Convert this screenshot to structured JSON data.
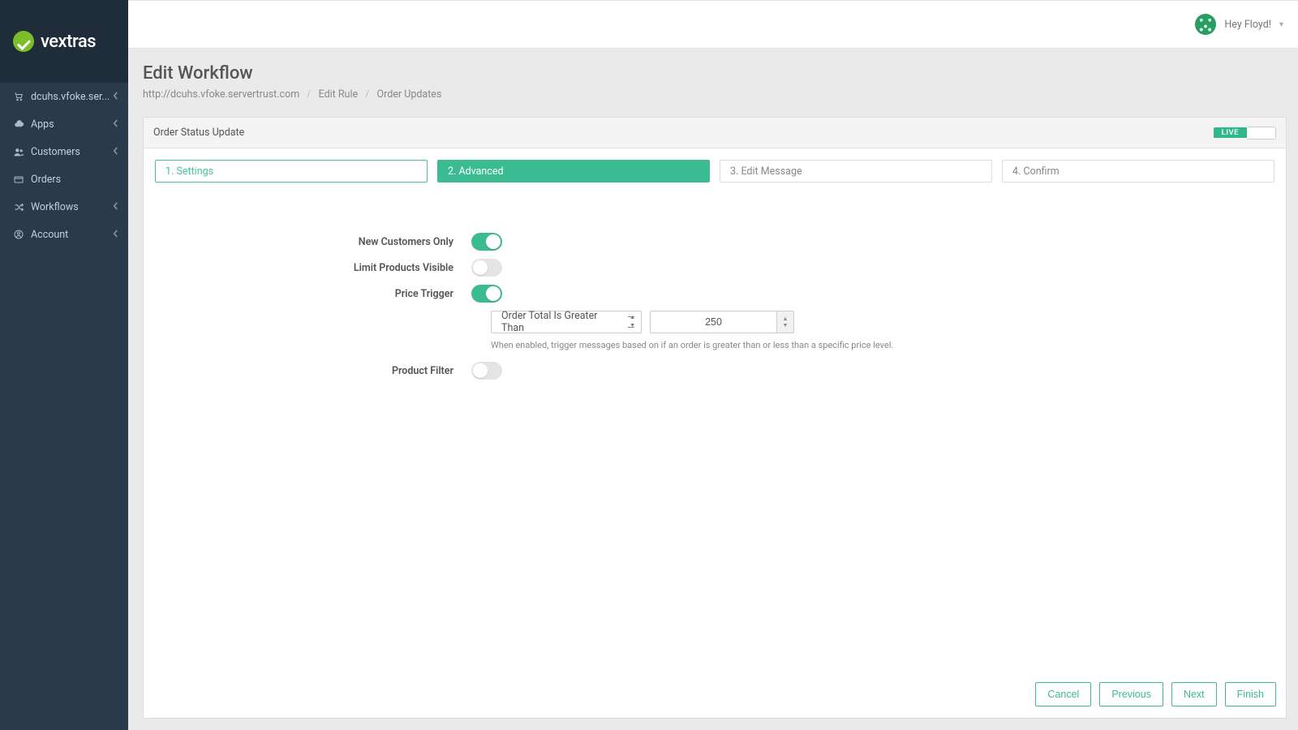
{
  "brand": {
    "name": "vextras"
  },
  "sidebar": {
    "items": [
      {
        "icon": "cart",
        "label": "dcuhs.vfoke.ser...",
        "hasSub": true
      },
      {
        "icon": "cloud",
        "label": "Apps",
        "hasSub": true
      },
      {
        "icon": "users",
        "label": "Customers",
        "hasSub": true
      },
      {
        "icon": "orders",
        "label": "Orders",
        "hasSub": false
      },
      {
        "icon": "shuffle",
        "label": "Workflows",
        "hasSub": true
      },
      {
        "icon": "user",
        "label": "Account",
        "hasSub": true
      }
    ]
  },
  "topbar": {
    "greeting": "Hey Floyd!"
  },
  "page": {
    "title": "Edit Workflow",
    "breadcrumbs": [
      "http://dcuhs.vfoke.servertrust.com",
      "Edit Rule",
      "Order Updates"
    ]
  },
  "card": {
    "title": "Order Status Update",
    "live_label": "LIVE",
    "steps": [
      {
        "num": "1",
        "label": "Settings",
        "state": "completed"
      },
      {
        "num": "2",
        "label": "Advanced",
        "state": "active"
      },
      {
        "num": "3",
        "label": "Edit Message",
        "state": "default"
      },
      {
        "num": "4",
        "label": "Confirm",
        "state": "default"
      }
    ]
  },
  "form": {
    "new_customers_only": {
      "label": "New Customers Only",
      "on": true
    },
    "limit_products_visible": {
      "label": "Limit Products Visible",
      "on": false
    },
    "price_trigger": {
      "label": "Price Trigger",
      "on": true,
      "condition": "Order Total Is Greater Than",
      "value": "250",
      "help": "When enabled, trigger messages based on if an order is greater than or less than a specific price level."
    },
    "product_filter": {
      "label": "Product Filter",
      "on": false
    }
  },
  "actions": {
    "cancel": "Cancel",
    "previous": "Previous",
    "next": "Next",
    "finish": "Finish"
  }
}
